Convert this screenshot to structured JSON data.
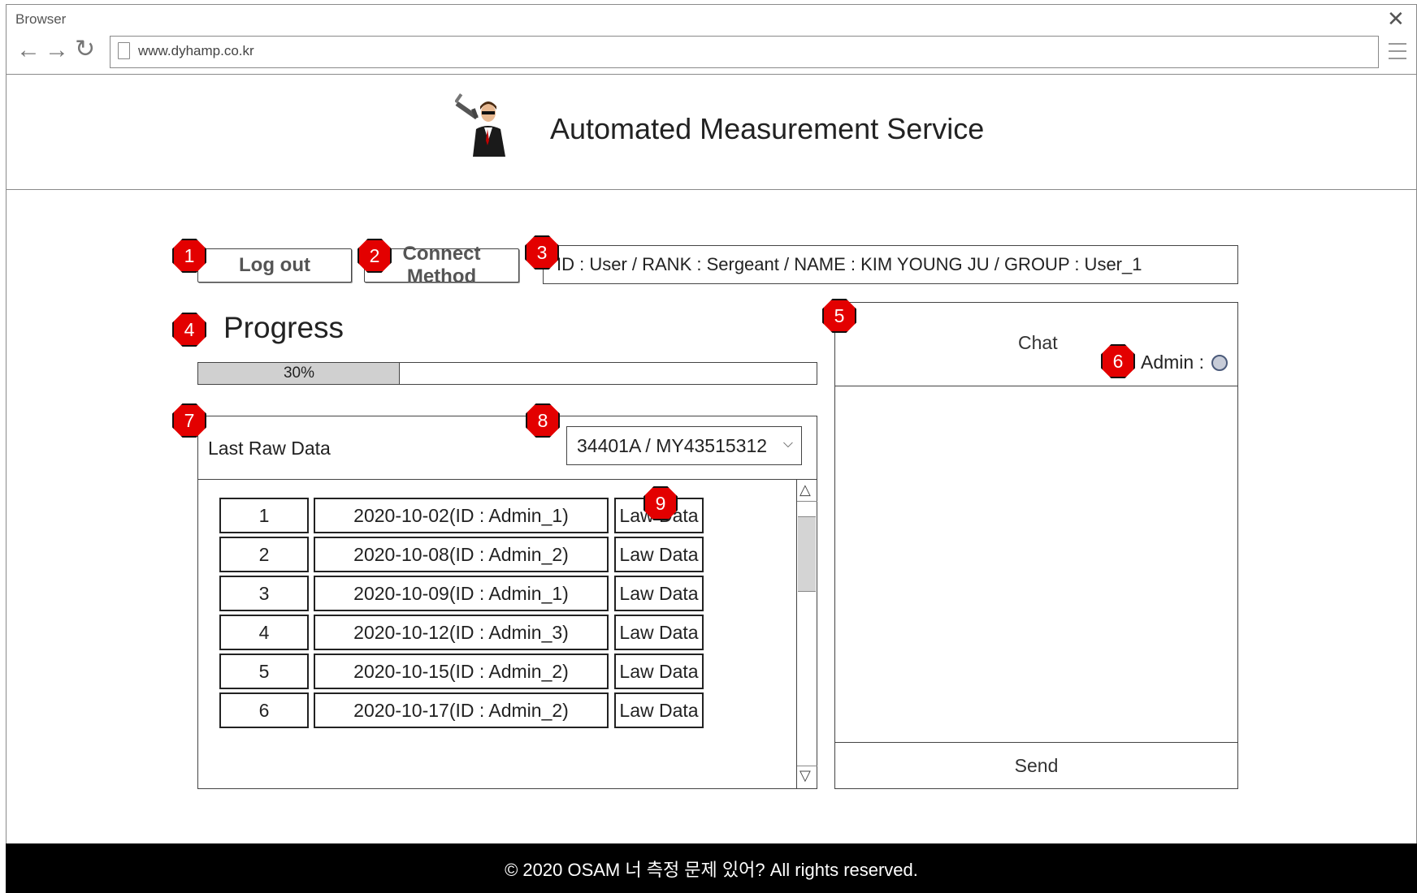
{
  "browser": {
    "title": "Browser",
    "url": "www.dyhamp.co.kr"
  },
  "header": {
    "title": "Automated Measurement Service",
    "logo_icon": "suited-man-with-gun-icon"
  },
  "controls": {
    "logout_label": "Log out",
    "connect_label": "Connect Method",
    "user_info": "ID : User / RANK : Sergeant / NAME : KIM YOUNG JU / GROUP : User_1"
  },
  "progress": {
    "title": "Progress",
    "value": 0.3,
    "label": "30%"
  },
  "raw_data": {
    "title": "Last Raw Data",
    "selected_device": "34401A / MY43515312",
    "rows": [
      {
        "no": "1",
        "entry": "2020-10-02(ID : Admin_1)",
        "action": "Law Data"
      },
      {
        "no": "2",
        "entry": "2020-10-08(ID : Admin_2)",
        "action": "Law Data"
      },
      {
        "no": "3",
        "entry": "2020-10-09(ID : Admin_1)",
        "action": "Law Data"
      },
      {
        "no": "4",
        "entry": "2020-10-12(ID : Admin_3)",
        "action": "Law Data"
      },
      {
        "no": "5",
        "entry": "2020-10-15(ID : Admin_2)",
        "action": "Law Data"
      },
      {
        "no": "6",
        "entry": "2020-10-17(ID : Admin_2)",
        "action": "Law Data"
      }
    ]
  },
  "chat": {
    "title": "Chat",
    "admin_label": "Admin :",
    "send_label": "Send"
  },
  "markers": [
    "1",
    "2",
    "3",
    "4",
    "5",
    "6",
    "7",
    "8",
    "9"
  ],
  "colors": {
    "marker": "#e30000",
    "footer_bg": "#000000",
    "progress_fill": "#d0d0d0",
    "status_dot": "#c7ccd8"
  },
  "footer": {
    "text": "© 2020 OSAM 너 측정 문제 있어? All rights reserved."
  }
}
